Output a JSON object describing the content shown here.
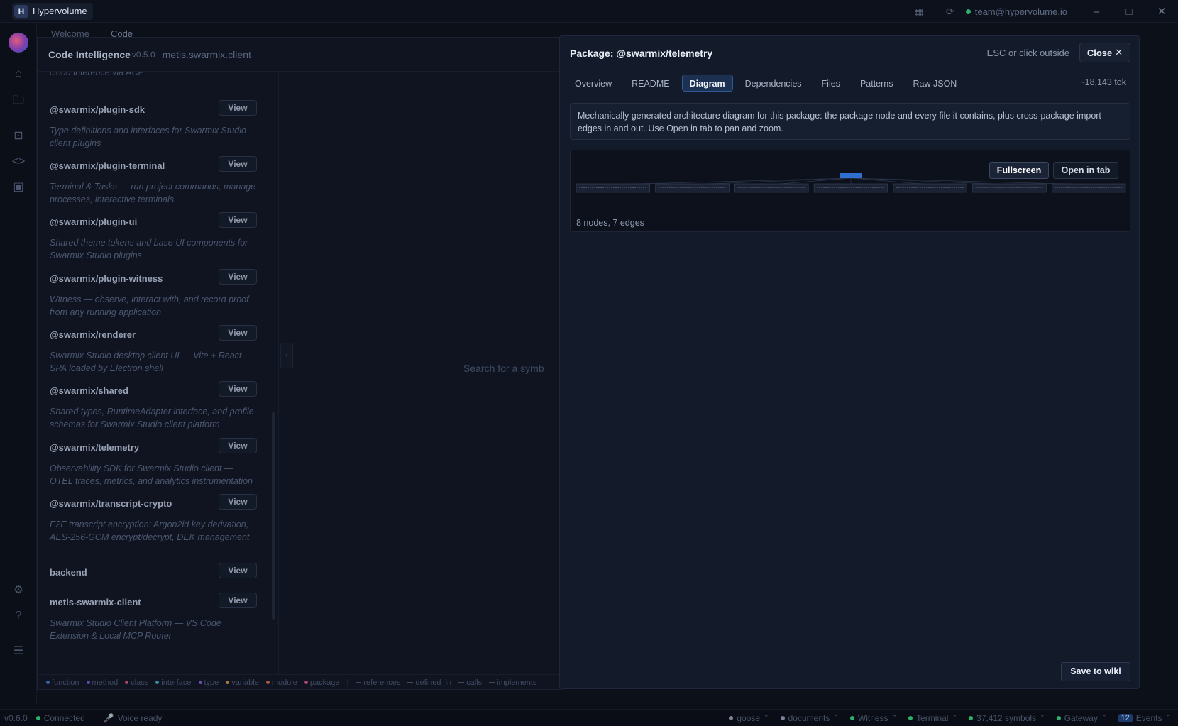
{
  "titlebar": {
    "app_badge": "H",
    "app_name": "Hypervolume",
    "user_email": "team@hypervolume.io"
  },
  "workspace": {
    "tabs": [
      "Welcome",
      "Code"
    ]
  },
  "code_intel": {
    "title": "Code Intelligence",
    "version": "v0.5.0",
    "project": "metis.swarmix.client",
    "view_label": "View",
    "search_hint": "Search for a symb",
    "packages": [
      {
        "name": "",
        "desc": "cloud inference via ACP"
      },
      {
        "name": "@swarmix/plugin-sdk",
        "desc": "Type definitions and interfaces for Swarmix Studio client plugins"
      },
      {
        "name": "@swarmix/plugin-terminal",
        "desc": "Terminal & Tasks — run project commands, manage processes, interactive terminals"
      },
      {
        "name": "@swarmix/plugin-ui",
        "desc": "Shared theme tokens and base UI components for Swarmix Studio plugins"
      },
      {
        "name": "@swarmix/plugin-witness",
        "desc": "Witness — observe, interact with, and record proof from any running application"
      },
      {
        "name": "@swarmix/renderer",
        "desc": "Swarmix Studio desktop client UI — Vite + React SPA loaded by Electron shell"
      },
      {
        "name": "@swarmix/shared",
        "desc": "Shared types, RuntimeAdapter interface, and profile schemas for Swarmix Studio client platform"
      },
      {
        "name": "@swarmix/telemetry",
        "desc": "Observability SDK for Swarmix Studio client — OTEL traces, metrics, and analytics instrumentation"
      },
      {
        "name": "@swarmix/transcript-crypto",
        "desc": "E2E transcript encryption: Argon2id key derivation, AES-256-GCM encrypt/decrypt, DEK management"
      },
      {
        "name": "backend",
        "desc": ""
      },
      {
        "name": "metis-swarmix-client",
        "desc": "Swarmix Studio Client Platform — VS Code Extension & Local MCP Router"
      }
    ],
    "legend": {
      "nodes": [
        {
          "label": "function",
          "color": "#3a63a8"
        },
        {
          "label": "method",
          "color": "#5a4fa8"
        },
        {
          "label": "class",
          "color": "#a8446c"
        },
        {
          "label": "interface",
          "color": "#3a8a9c"
        },
        {
          "label": "type",
          "color": "#6c4fa8"
        },
        {
          "label": "variable",
          "color": "#a8783a"
        },
        {
          "label": "module",
          "color": "#a85a3a"
        },
        {
          "label": "package",
          "color": "#a8446c"
        }
      ],
      "edges": [
        "references",
        "defined_in",
        "calls",
        "implements"
      ]
    }
  },
  "modal": {
    "title": "Package: @swarmix/telemetry",
    "hint": "ESC or click outside",
    "close_label": "Close",
    "tabs": [
      "Overview",
      "README",
      "Diagram",
      "Dependencies",
      "Files",
      "Patterns",
      "Raw JSON"
    ],
    "active_tab": "Diagram",
    "token_count": "~18,143 tok",
    "description": "Mechanically generated architecture diagram for this package: the package node and every file it contains, plus cross-package import edges in and out. Use Open in tab to pan and zoom.",
    "fullscreen_label": "Fullscreen",
    "open_tab_label": "Open in tab",
    "graph_stats": "8 nodes, 7 edges",
    "save_label": "Save to wiki",
    "diagram": {
      "node_count": 8,
      "edge_count": 7,
      "child_nodes": 7,
      "accent": "#2e6fd1"
    }
  },
  "statusbar": {
    "version": "v0.6.0",
    "connected": "Connected",
    "voice": "Voice ready",
    "items": [
      {
        "label": "goose",
        "color": "#7b8496"
      },
      {
        "label": "documents",
        "color": "#7b8496"
      },
      {
        "label": "Witness",
        "color": "#2bb36d"
      },
      {
        "label": "Terminal",
        "color": "#2bb36d"
      },
      {
        "label": "37,412 symbols",
        "color": "#2bb36d"
      },
      {
        "label": "Gateway",
        "color": "#2bb36d"
      }
    ],
    "events_count": "12",
    "events_label": "Events"
  }
}
